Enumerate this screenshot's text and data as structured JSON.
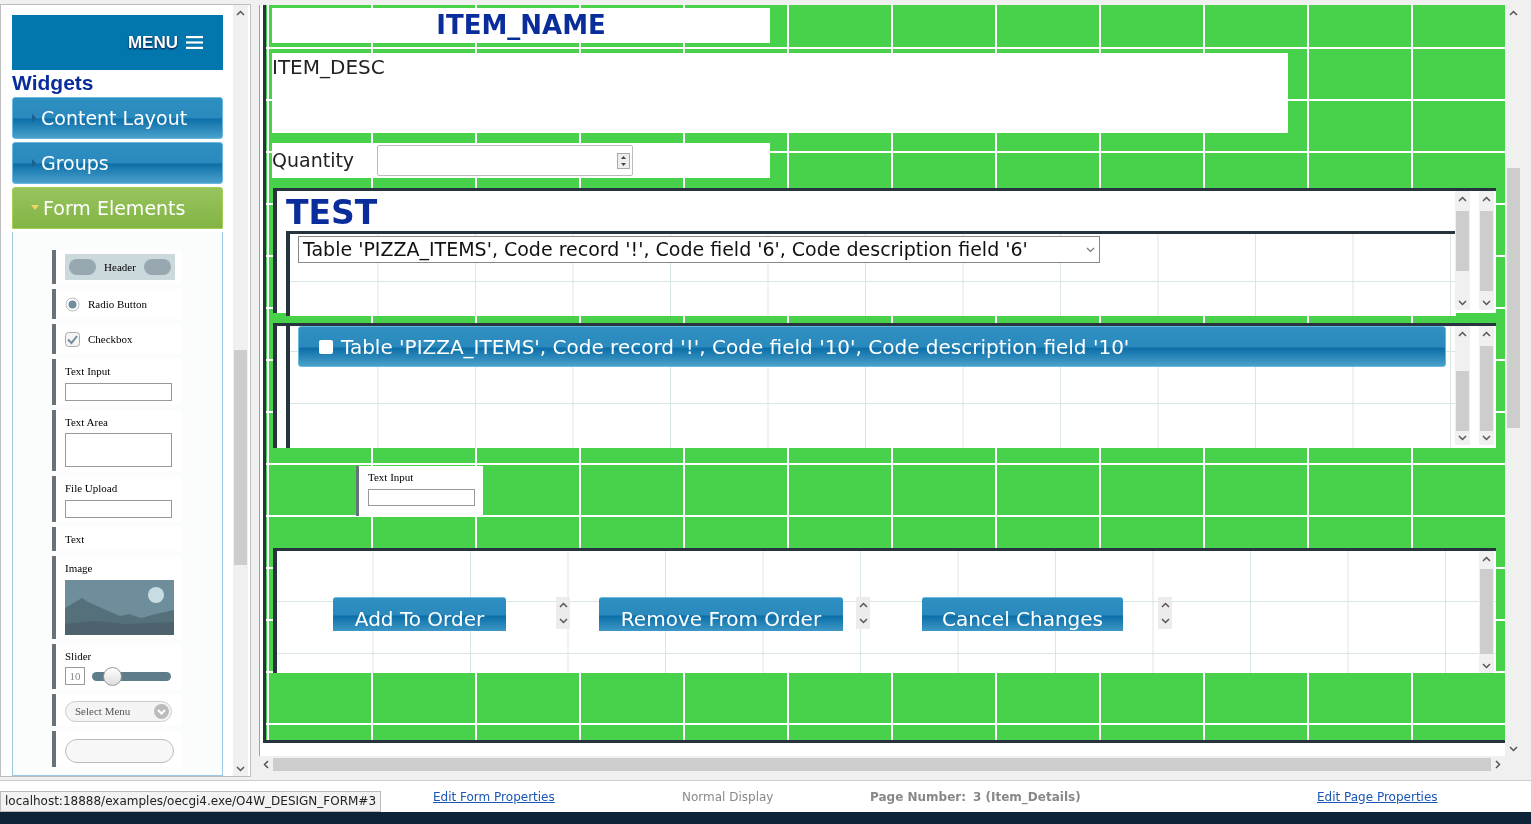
{
  "sidebar": {
    "menu_label": "MENU",
    "title": "Widgets",
    "sections": [
      {
        "label": "Content Layout",
        "expanded": false
      },
      {
        "label": "Groups",
        "expanded": false
      },
      {
        "label": "Form Elements",
        "expanded": true
      }
    ],
    "palette": [
      {
        "kind": "header",
        "label": "Header"
      },
      {
        "kind": "radio",
        "label": "Radio Button",
        "checked": true
      },
      {
        "kind": "checkbox",
        "label": "Checkbox",
        "checked": true
      },
      {
        "kind": "input",
        "label": "Text Input"
      },
      {
        "kind": "textarea",
        "label": "Text Area"
      },
      {
        "kind": "file",
        "label": "File Upload"
      },
      {
        "kind": "text",
        "label": "Text"
      },
      {
        "kind": "image",
        "label": "Image"
      },
      {
        "kind": "slider",
        "label": "Slider",
        "value": "10",
        "level": 0.25
      },
      {
        "kind": "select",
        "label": "Select Menu"
      },
      {
        "kind": "button"
      }
    ]
  },
  "canvas": {
    "item_name": "ITEM_NAME",
    "item_desc": "ITEM_DESC",
    "quantity_label": "Quantity",
    "test_panel": {
      "title": "TEST",
      "select_value": "Table 'PIZZA_ITEMS', Code record '!', Code field '6', Code description field '6'"
    },
    "collapsible": {
      "label": "Table 'PIZZA_ITEMS', Code record '!', Code field '10', Code description field '10'",
      "checked": false
    },
    "text_input_widget": {
      "label": "Text Input"
    },
    "buttons": [
      {
        "label": "Add To Order"
      },
      {
        "label": "Remove From Order"
      },
      {
        "label": "Cancel Changes"
      }
    ]
  },
  "status_bar": {
    "url": "localhost:18888/examples/oecgi4.exe/O4W_DESIGN_FORM#3",
    "edit_form_link": "Edit Form Properties",
    "display_mode": "Normal Display",
    "page_number_label": "Page Number:",
    "page_number_value": "3 (Item_Details)",
    "edit_page_link": "Edit Page Properties"
  }
}
